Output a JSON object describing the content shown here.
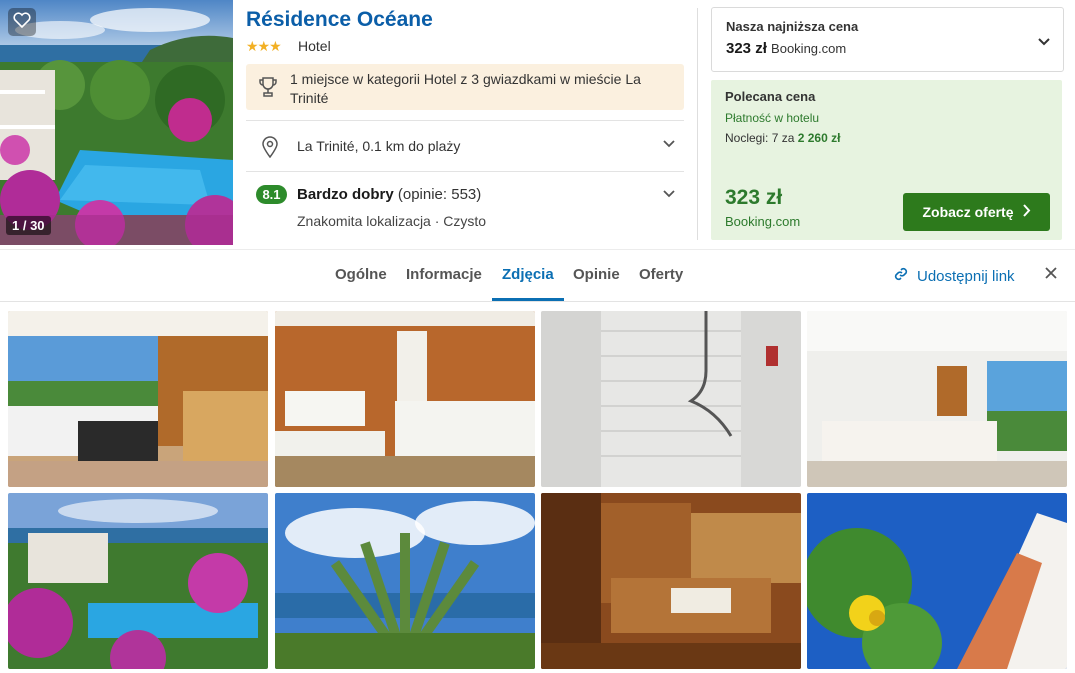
{
  "hero": {
    "counter": "1 / 30"
  },
  "hotel": {
    "name": "Résidence Océane",
    "stars": "★★★",
    "type": "Hotel",
    "award": "1 miejsce w kategorii Hotel z 3 gwiazdkami w mieście La Trinité",
    "location": "La Trinité, 0.1 km do plaży",
    "rating": {
      "score": "8.1",
      "label": "Bardzo dobry",
      "reviews": "(opinie: 553)",
      "highlights": "Znakomita lokalizacja · Czysto"
    }
  },
  "price": {
    "lowest_label": "Nasza najniższa cena",
    "lowest_value": "323 zł",
    "lowest_site": "Booking.com",
    "recommended_label": "Polecana cena",
    "payment": "Płatność w hotelu",
    "nights_prefix": "Noclegi: 7 za",
    "nights_total": "2 260 zł",
    "recommended_value": "323 zł",
    "recommended_site": "Booking.com",
    "cta": "Zobacz ofertę"
  },
  "tabs": [
    "Ogólne",
    "Informacje",
    "Zdjęcia",
    "Opinie",
    "Oferty"
  ],
  "active_tab": "Zdjęcia",
  "share_label": "Udostępnij link",
  "icons": {
    "favorite": "heart-icon",
    "award": "trophy-icon",
    "location": "map-pin-icon",
    "share": "link-icon",
    "close": "close-icon"
  },
  "colors": {
    "brand_blue": "#0b6fb3",
    "rating_green": "#2d8b2b",
    "cta_green": "#2d7a1c",
    "award_bg": "#fbf0df",
    "recommended_bg": "#e7f3e0"
  }
}
